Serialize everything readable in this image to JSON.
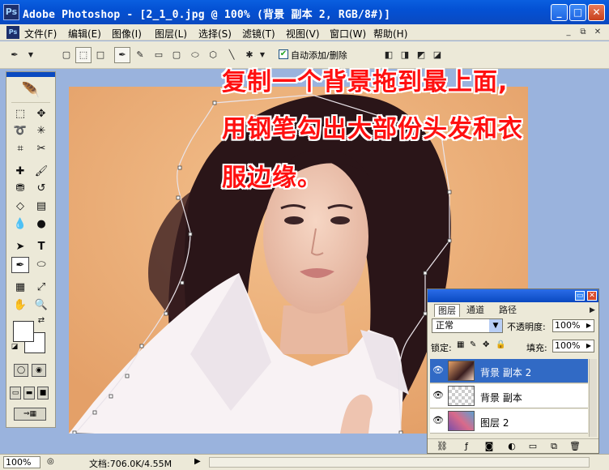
{
  "window": {
    "logo": "Ps",
    "title": "Adobe Photoshop - [2_1_0.jpg @ 100% (背景 副本 2, RGB/8#)]",
    "buttons": {
      "minimize": "_",
      "maximize": "□",
      "close": "✕"
    }
  },
  "menubar": {
    "items": [
      "文件(F)",
      "编辑(E)",
      "图像(I)",
      "图层(L)",
      "选择(S)",
      "滤镜(T)",
      "视图(V)",
      "窗口(W)",
      "帮助(H)"
    ],
    "doc_controls": [
      "_",
      "⧉",
      "✕"
    ]
  },
  "options_bar": {
    "auto_add_delete_label": "自动添加/删除",
    "auto_add_delete_checked": true
  },
  "overlay": {
    "line1": "复制一个背景拖到最上面,",
    "line2": "用钢笔勾出大部份头发和衣",
    "line3": "服边缘。",
    "color": "#ff1010"
  },
  "status": {
    "zoom": "100%",
    "doc_info": "文档:706.0K/4.55M"
  },
  "layers_panel": {
    "tabs": [
      "图层",
      "通道",
      "路径"
    ],
    "active_tab": "图层",
    "blend_mode": "正常",
    "opacity_label": "不透明度:",
    "opacity_value": "100%",
    "lock_label": "锁定:",
    "fill_label": "填充:",
    "fill_value": "100%",
    "layers": [
      {
        "name": "背景 副本 2",
        "selected": true
      },
      {
        "name": "背景 副本",
        "selected": false
      },
      {
        "name": "图层 2",
        "selected": false
      }
    ]
  },
  "icons": {
    "eye": "eye-icon",
    "pen": "pen-tool-icon"
  }
}
